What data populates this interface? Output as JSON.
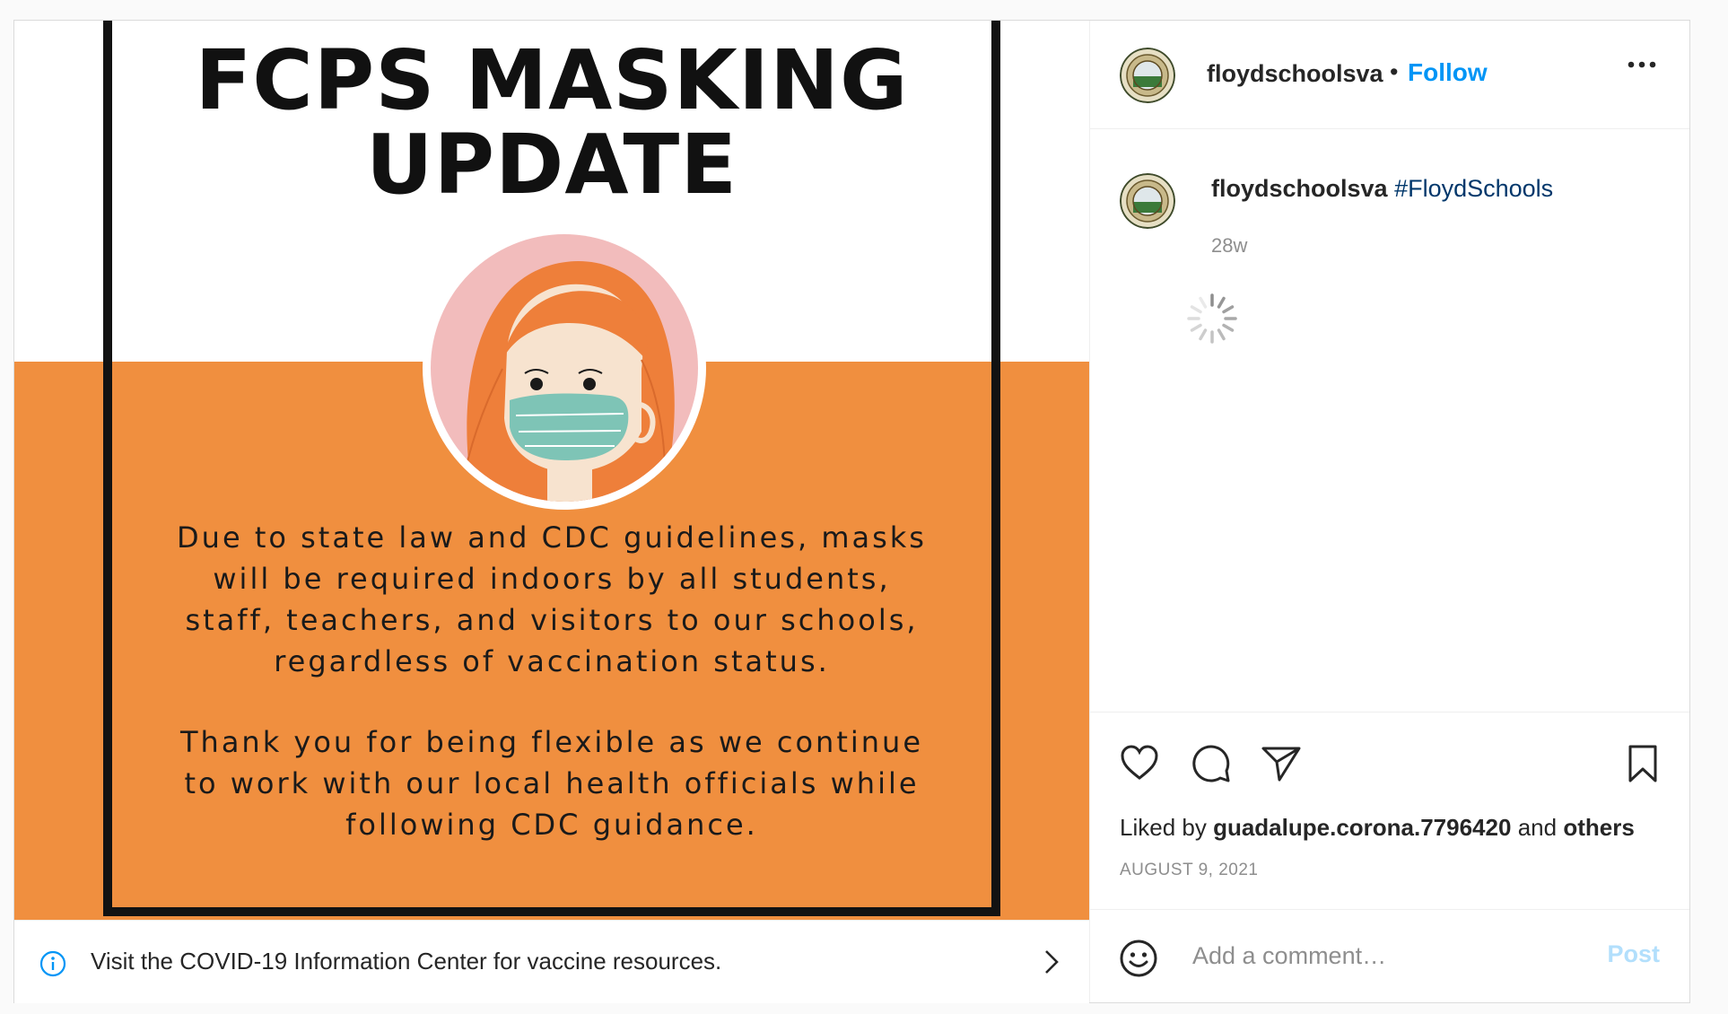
{
  "poster": {
    "title_line1": "FCPS MASKING",
    "title_line2": "UPDATE",
    "paragraph1": [
      "Due to state law and CDC guidelines, masks",
      "will be required indoors by all students,",
      "staff, teachers, and visitors to our schools,",
      "regardless of vaccination status."
    ],
    "paragraph2": [
      "Thank you for being flexible as we continue",
      "to work with our local health officials while",
      "following CDC guidance."
    ],
    "bg_orange": "#f08f3f"
  },
  "covid_banner": {
    "text": "Visit the COVID-19 Information Center for vaccine resources."
  },
  "header": {
    "username": "floydschoolsva",
    "separator": "•",
    "follow_label": "Follow"
  },
  "caption": {
    "username": "floydschoolsva",
    "hashtag": "#FloydSchools",
    "time": "28w"
  },
  "likes": {
    "prefix": "Liked by",
    "user": "guadalupe.corona.7796420",
    "joiner": "and",
    "others": "others"
  },
  "date": "AUGUST 9, 2021",
  "comment": {
    "placeholder": "Add a comment…",
    "post_label": "Post"
  },
  "colors": {
    "accent": "#0095f6",
    "post_disabled": "#b2dffc",
    "hashtag": "#00376b"
  },
  "icons": [
    "info-icon",
    "chevron-right-icon",
    "more-icon",
    "spinner-icon",
    "heart-icon",
    "comment-icon",
    "share-icon",
    "bookmark-icon",
    "smiley-icon"
  ]
}
